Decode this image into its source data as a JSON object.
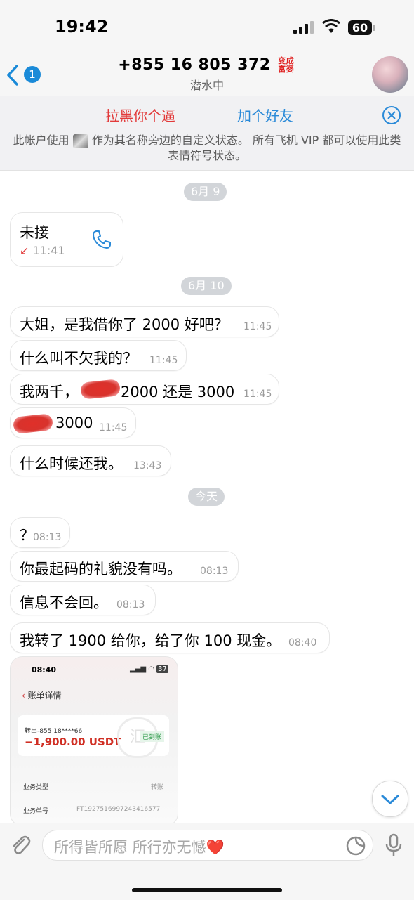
{
  "status_bar": {
    "time": "19:42",
    "battery": "60"
  },
  "header": {
    "back_count": "1",
    "title": "+855 16 805 372",
    "title_badge": "变成富婆",
    "subtitle": "潜水中"
  },
  "action_bar": {
    "block_label": "拉黑你个逼",
    "add_label": "加个好友",
    "notice_part1": "此帐户使用",
    "notice_part2": "作为其名称旁边的自定义状态。 所有飞机 VIP 都可以使用此类表情符号状态。"
  },
  "chat": {
    "dates": [
      "6月 9",
      "6月 10",
      "今天"
    ],
    "call": {
      "title": "未接",
      "arrow": "↙",
      "time": "11:41"
    },
    "messages": [
      {
        "text": "大姐，是我借你了 2000 好吧？",
        "time": "11:45"
      },
      {
        "text": "什么叫不欠我的？",
        "time": "11:45"
      },
      {
        "text_before": "我两千，",
        "text_after": "2000 还是 3000",
        "time": "11:45"
      },
      {
        "text_after": "3000",
        "time": "11:45"
      },
      {
        "text": "什么时候还我。",
        "time": "13:43"
      },
      {
        "text": "？",
        "time": "08:13"
      },
      {
        "text": "你最起码的礼貌没有吗。",
        "time": "08:13"
      },
      {
        "text": "信息不会回。",
        "time": "08:13"
      },
      {
        "text": "我转了 1900 给你，给了你 100 现金。",
        "time": "08:40"
      }
    ],
    "receipt": {
      "time": "08:40",
      "battery": "37",
      "back_label": "账单详情",
      "from": "转出-855 18****66",
      "amount": "−1,900.00 USDT",
      "stamp": "汇",
      "status": "已到账",
      "type_label": "业务类型",
      "type_value": "转账",
      "no_label": "业务单号",
      "no_value": "FT192751699724341657​7"
    }
  },
  "composer": {
    "placeholder": "所得皆所愿 所行亦无憾❤️"
  }
}
